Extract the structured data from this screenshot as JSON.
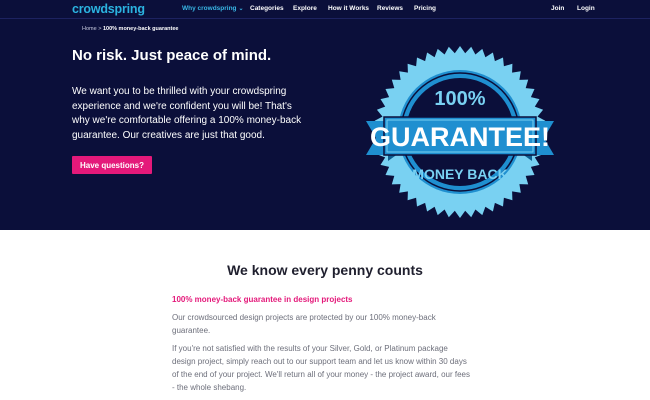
{
  "nav": {
    "logo": "crowdspring",
    "items": [
      {
        "label": "Why crowdspring",
        "active": true,
        "dropdown": true
      },
      {
        "label": "Categories"
      },
      {
        "label": "Explore"
      },
      {
        "label": "How it Works"
      },
      {
        "label": "Reviews"
      },
      {
        "label": "Pricing"
      }
    ],
    "right": [
      {
        "label": "Join"
      },
      {
        "label": "Login"
      }
    ]
  },
  "breadcrumb": {
    "home": "Home",
    "separator": ">",
    "current": "100% money-back guarantee"
  },
  "hero": {
    "title": "No risk. Just peace of mind.",
    "body": "We want you to be thrilled with your crowdspring experience and we're confident you will be! That's why we're comfortable offering a 100% money-back guarantee. Our creatives are just that good.",
    "cta": "Have questions?"
  },
  "badge": {
    "top": "100%",
    "middle": "GUARANTEE!",
    "bottom": "MONEY BACK"
  },
  "section": {
    "title": "We know every penny counts",
    "subhead": "100% money-back guarantee in design projects",
    "p1": "Our crowdsourced design projects are protected by our 100% money-back guarantee.",
    "p2": "If you're not satisfied with the results of your Silver, Gold, or Platinum package design project, simply reach out to our support team and let us know within 30 days of the end of your project. We'll return all of your money - the project award, our fees - the whole shebang."
  },
  "colors": {
    "navy": "#0b0f3a",
    "brand_blue": "#2bb3e0",
    "accent_pink": "#e4197a",
    "badge_light": "#79d1f2",
    "badge_mid": "#1f8fd0"
  }
}
